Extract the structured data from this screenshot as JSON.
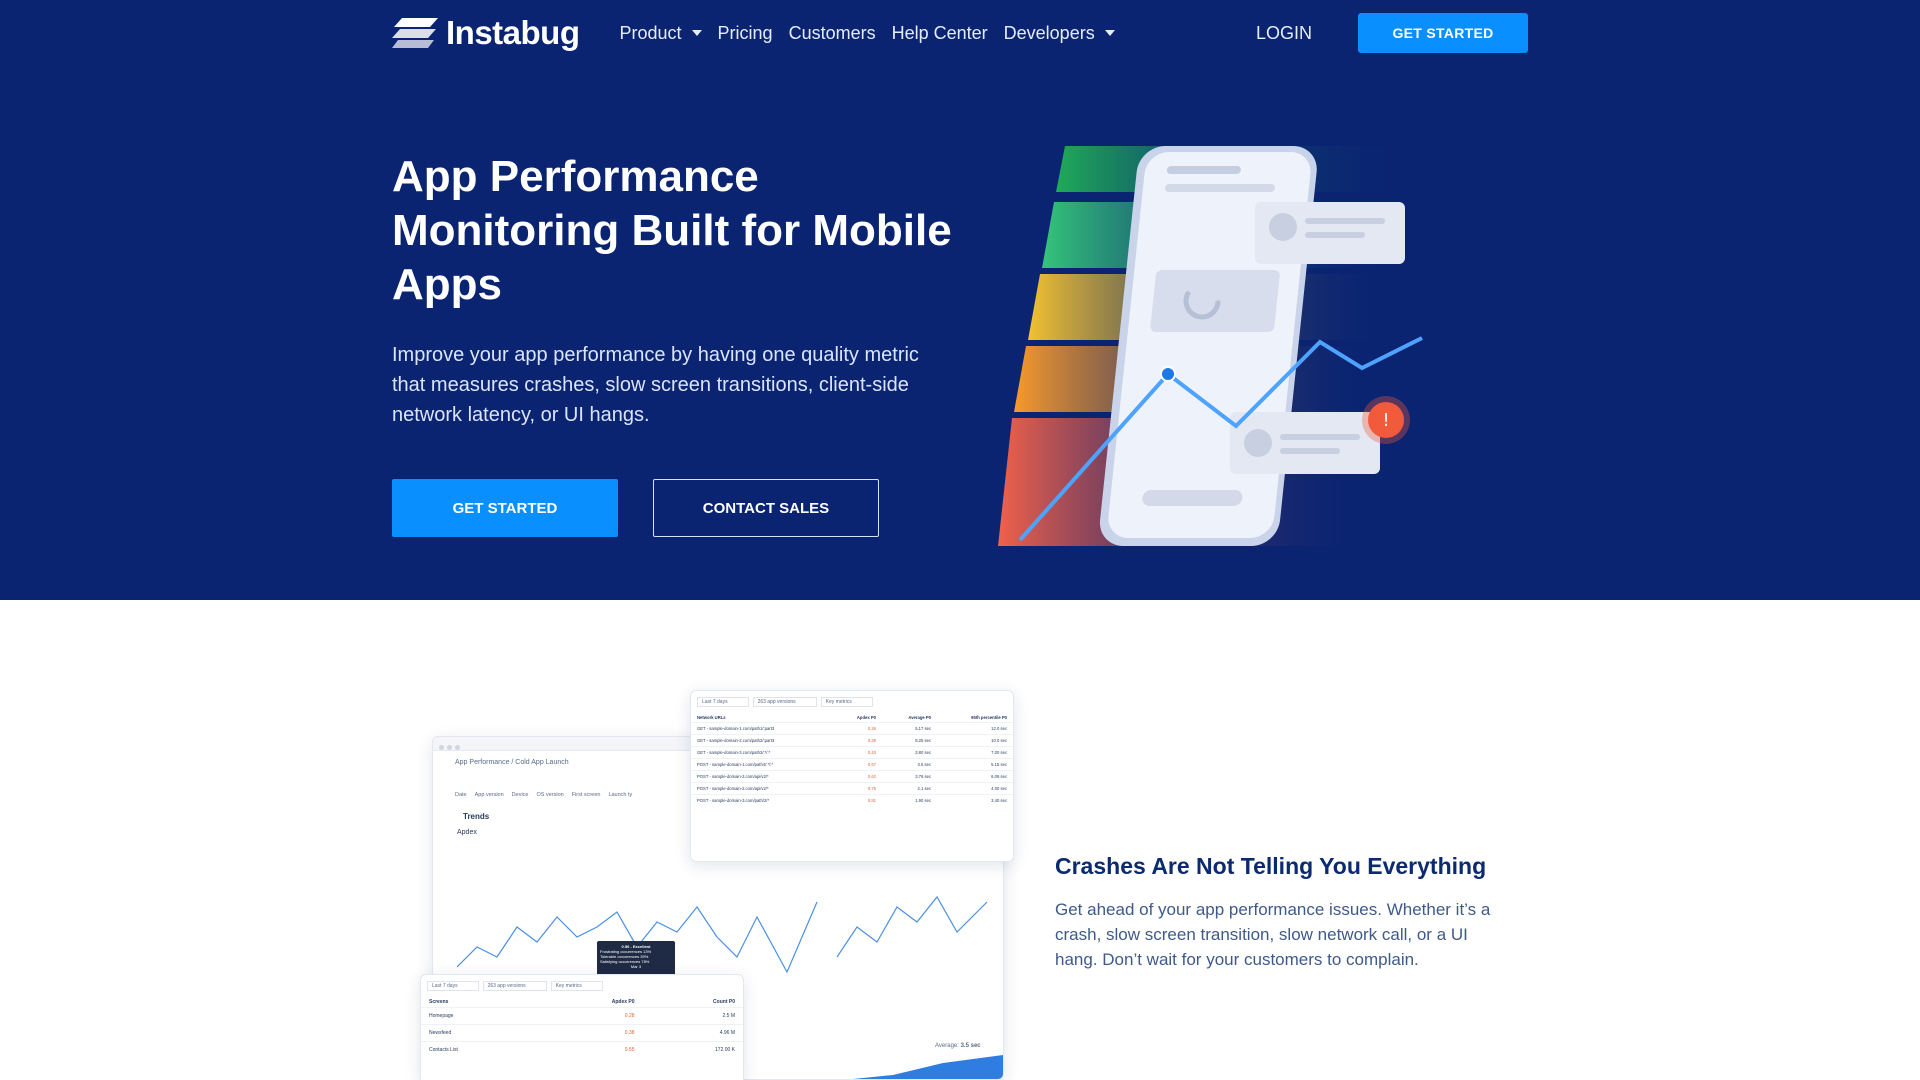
{
  "brand": {
    "name": "Instabug"
  },
  "nav": {
    "items": [
      {
        "label": "Product",
        "dropdown": true
      },
      {
        "label": "Pricing",
        "dropdown": false
      },
      {
        "label": "Customers",
        "dropdown": false
      },
      {
        "label": "Help Center",
        "dropdown": false
      },
      {
        "label": "Developers",
        "dropdown": true
      }
    ],
    "login": "LOGIN",
    "cta": "GET STARTED"
  },
  "hero": {
    "title": "App Performance Monitoring Built for Mobile Apps",
    "subtitle": "Improve your app performance by having one quality metric that measures crashes, slow screen transitions, client-side network latency, or UI hangs.",
    "primary_button": "GET STARTED",
    "secondary_button": "CONTACT SALES"
  },
  "feature": {
    "title": "Crashes Are Not Telling You Everything",
    "text": "Get ahead of your app performance issues. Whether it’s a crash, slow screen transition, slow network call, or a UI hang. Don’t wait for your customers to complain.",
    "dashboard": {
      "breadcrumb": "App Performance / Cold App Launch",
      "section": "Trends",
      "metric": "Apdex",
      "filters": [
        "Date",
        "App version",
        "Device",
        "OS version",
        "First screen",
        "Launch ty"
      ],
      "list_header": [
        "Screens",
        "Apdex P0",
        "Count P0"
      ],
      "screens": [
        {
          "name": "Homepage",
          "apdex": "0.28",
          "count": "2.5 M"
        },
        {
          "name": "Newsfeed",
          "apdex": "0.38",
          "count": "4.96 M"
        },
        {
          "name": "Contacts List",
          "apdex": "0.55",
          "count": "172.00 K"
        }
      ],
      "network_header": [
        "Network URLs",
        "Apdex P0",
        "Average P0",
        "95th percentile P0"
      ],
      "network_rows": [
        {
          "url": "GET - sample-domain-1.com/path1/:part3",
          "apdex": "0.26",
          "avg": "5.17 sec",
          "p95": "12.0 sec"
        },
        {
          "url": "GET - sample-domain-2.com/path2/:part3",
          "apdex": "0.28",
          "avg": "8.25 sec",
          "p95": "10.0 sec"
        },
        {
          "url": "GET - sample-domain-3.com/path3/:*/:*",
          "apdex": "0.43",
          "avg": "3.80 sec",
          "p95": "7.00 sec"
        },
        {
          "url": "POST - sample-domain-1.com/path4/:*/:*",
          "apdex": "0.67",
          "avg": "3.6 sec",
          "p95": "5.15 sec"
        },
        {
          "url": "POST - sample-domain-2.com/api/v2/*",
          "apdex": "0.62",
          "avg": "3.76 sec",
          "p95": "6.09 sec"
        },
        {
          "url": "POST - sample-domain-2.com/api/v2/*",
          "apdex": "0.75",
          "avg": "2.1 sec",
          "p95": "4.00 sec"
        },
        {
          "url": "POST - sample-domain-3.com/path/2/*",
          "apdex": "0.81",
          "avg": "1.90 sec",
          "p95": "3.40 sec"
        }
      ],
      "tooltip": {
        "title": "0.56 - Excellent",
        "rows": [
          "Frustrating occurrences 13%",
          "Tolerable occurrences 39%",
          "Satisfying occurrences 78%"
        ],
        "footer": "Mar 3"
      },
      "average": {
        "label": "Average",
        "value": "3.5 sec"
      }
    }
  }
}
